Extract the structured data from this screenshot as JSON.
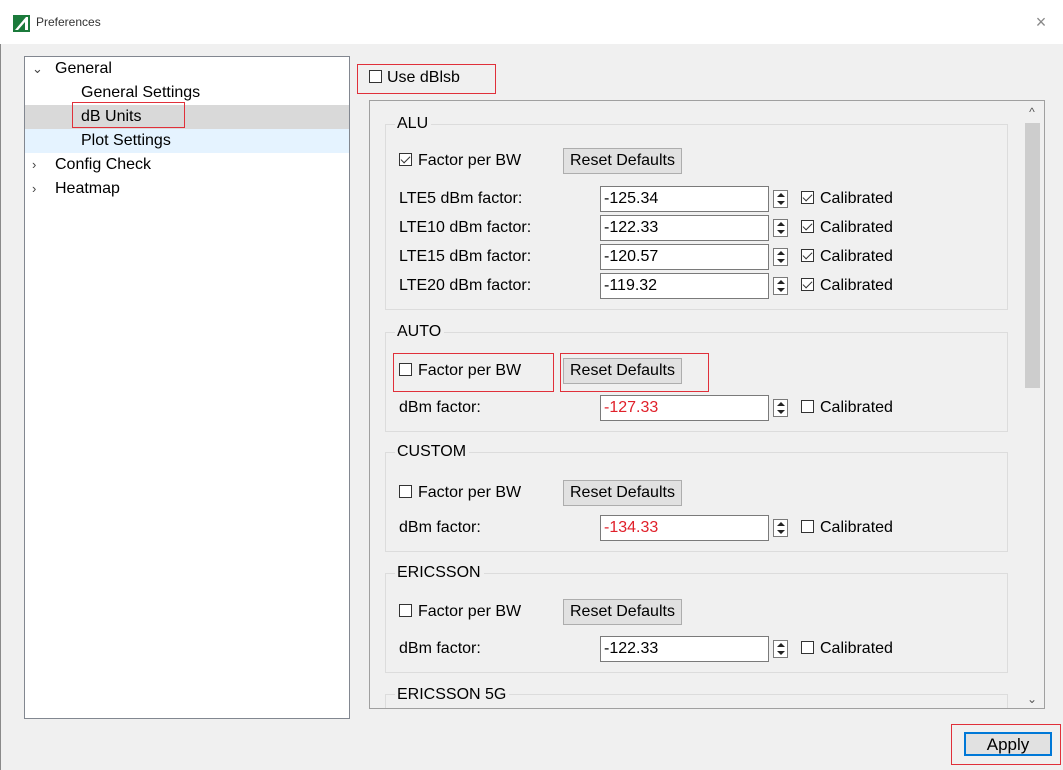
{
  "window": {
    "title": "Preferences",
    "close_glyph": "×"
  },
  "tree": {
    "items": [
      {
        "label": "General",
        "chevron": "⌄"
      },
      {
        "label": "General Settings"
      },
      {
        "label": "dB Units"
      },
      {
        "label": "Plot Settings"
      },
      {
        "label": "Config Check",
        "chevron": "›"
      },
      {
        "label": "Heatmap",
        "chevron": "›"
      }
    ]
  },
  "use_dbi": {
    "label": "Use dBlsb",
    "checked": false
  },
  "groups": [
    {
      "title": "ALU",
      "factor_per_bw": {
        "label": "Factor per BW",
        "checked": true
      },
      "reset_label": "Reset Defaults",
      "rows": [
        {
          "label": "LTE5 dBm factor:",
          "value": "-125.34",
          "calibrated": "Calibrated"
        },
        {
          "label": "LTE10 dBm factor:",
          "value": "-122.33",
          "calibrated": "Calibrated"
        },
        {
          "label": "LTE15 dBm factor:",
          "value": "-120.57",
          "calibrated": "Calibrated"
        },
        {
          "label": "LTE20 dBm factor:",
          "value": "-119.32",
          "calibrated": "Calibrated"
        }
      ]
    },
    {
      "title": "AUTO",
      "factor_per_bw": {
        "label": "Factor per BW",
        "checked": false
      },
      "reset_label": "Reset Defaults",
      "rows": [
        {
          "label": "dBm factor:",
          "value": "-127.33",
          "calibrated": "Calibrated"
        }
      ]
    },
    {
      "title": "CUSTOM",
      "factor_per_bw": {
        "label": "Factor per BW",
        "checked": false
      },
      "reset_label": "Reset Defaults",
      "rows": [
        {
          "label": "dBm factor:",
          "value": "-134.33",
          "calibrated": "Calibrated"
        }
      ]
    },
    {
      "title": "ERICSSON",
      "factor_per_bw": {
        "label": "Factor per BW",
        "checked": false
      },
      "reset_label": "Reset Defaults",
      "rows": [
        {
          "label": "dBm factor:",
          "value": "-122.33",
          "calibrated": "Calibrated"
        }
      ]
    },
    {
      "title": "ERICSSON 5G"
    }
  ],
  "scrollbar": {
    "up_glyph": "^",
    "down_glyph": "⌄"
  },
  "apply_label": "Apply",
  "colors": {
    "highlight": "#e0303a",
    "modified_value": "#e0202a",
    "focus": "#0078d7",
    "selected_row": "#d9d9d9"
  }
}
